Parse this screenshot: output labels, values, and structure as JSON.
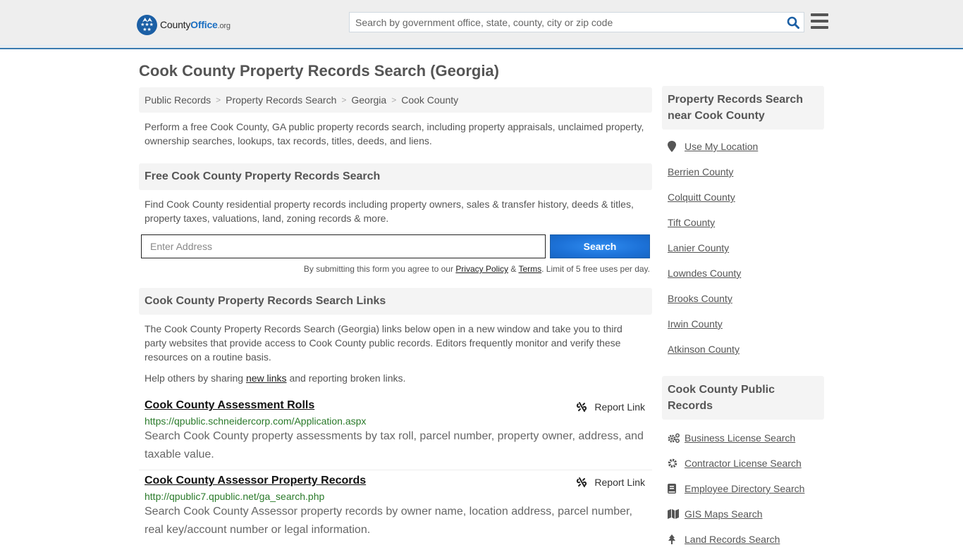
{
  "header": {
    "logo": {
      "name_part1": "County",
      "name_part2": "Office",
      "tld": ".org"
    },
    "search_placeholder": "Search by government office, state, county, city or zip code"
  },
  "page_title": "Cook County Property Records Search (Georgia)",
  "breadcrumb": [
    "Public Records",
    "Property Records Search",
    "Georgia",
    "Cook County"
  ],
  "breadcrumb_separator": ">",
  "intro": "Perform a free Cook County, GA public property records search, including property appraisals, unclaimed property, ownership searches, lookups, tax records, titles, deeds, and liens.",
  "free_search": {
    "heading": "Free Cook County Property Records Search",
    "description": "Find Cook County residential property records including property owners, sales & transfer history, deeds & titles, property taxes, valuations, land, zoning records & more.",
    "address_placeholder": "Enter Address",
    "button_label": "Search",
    "disclaimer_prefix": "By submitting this form you agree to our ",
    "privacy_label": "Privacy Policy",
    "amp": " & ",
    "terms_label": "Terms",
    "disclaimer_suffix": ". Limit of 5 free uses per day."
  },
  "links_section": {
    "heading": "Cook County Property Records Search Links",
    "description": "The Cook County Property Records Search (Georgia) links below open in a new window and take you to third party websites that provide access to Cook County public records. Editors frequently monitor and verify these resources on a routine basis.",
    "help_prefix": "Help others by sharing ",
    "help_link": "new links",
    "help_suffix": " and reporting broken links.",
    "report_label": "Report Link",
    "items": [
      {
        "title": "Cook County Assessment Rolls",
        "url": "https://qpublic.schneidercorp.com/Application.aspx",
        "description": "Search Cook County property assessments by tax roll, parcel number, property owner, address, and taxable value."
      },
      {
        "title": "Cook County Assessor Property Records",
        "url": "http://qpublic7.qpublic.net/ga_search.php",
        "description": "Search Cook County Assessor property records by owner name, location address, parcel number, real key/account number or legal information."
      }
    ]
  },
  "sidebar": {
    "nearby": {
      "heading": "Property Records Search near Cook County",
      "use_location": "Use My Location",
      "counties": [
        "Berrien County",
        "Colquitt County",
        "Tift County",
        "Lanier County",
        "Lowndes County",
        "Brooks County",
        "Irwin County",
        "Atkinson County"
      ]
    },
    "public_records": {
      "heading": "Cook County Public Records",
      "items": [
        {
          "label": "Business License Search",
          "icon": "cogs-icon"
        },
        {
          "label": "Contractor License Search",
          "icon": "gear-icon"
        },
        {
          "label": "Employee Directory Search",
          "icon": "book-icon"
        },
        {
          "label": "GIS Maps Search",
          "icon": "map-icon"
        },
        {
          "label": "Land Records Search",
          "icon": "tree-icon"
        }
      ]
    }
  }
}
